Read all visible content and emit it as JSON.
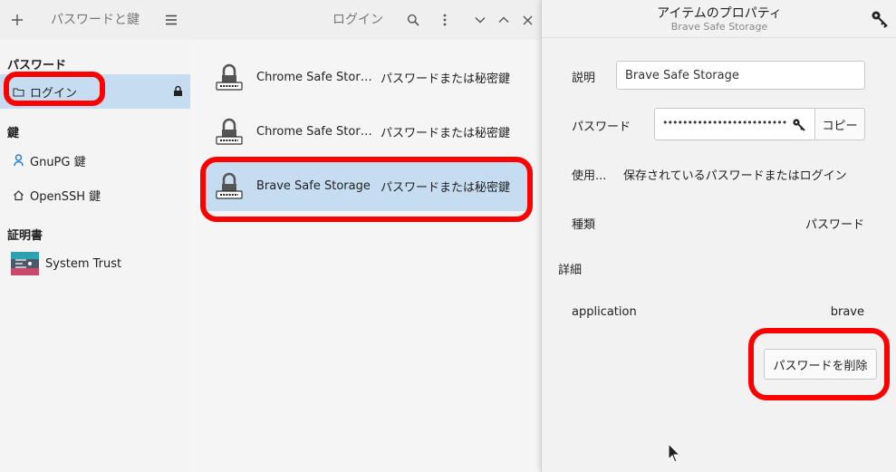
{
  "header": {
    "add_icon": "plus-icon",
    "title": "パスワードと鍵",
    "menu_icon": "hamburger-menu-icon",
    "section_title": "ログイン",
    "search_icon": "search-icon",
    "more_icon": "vertical-dots-icon",
    "down_icon": "chevron-down-icon",
    "up_icon": "chevron-up-icon",
    "close_icon": "close-icon"
  },
  "sidebar": {
    "passwords_header": "パスワード",
    "login_label": "ログイン",
    "keys_header": "鍵",
    "gnupg_label": "GnuPG 鍵",
    "openssh_label": "OpenSSH 鍵",
    "certs_header": "証明書",
    "system_trust_label": "System Trust"
  },
  "list": {
    "rows": [
      {
        "name": "Chrome Safe Storage",
        "type": "パスワードまたは秘密鍵"
      },
      {
        "name": "Chrome Safe Storag...",
        "type": "パスワードまたは秘密鍵"
      },
      {
        "name": "Brave Safe Storage",
        "type": "パスワードまたは秘密鍵"
      }
    ]
  },
  "panel": {
    "title": "アイテムのプロパティ",
    "subtitle": "Brave Safe Storage",
    "description_label": "説明",
    "description_value": "Brave Safe Storage",
    "password_label": "パスワード",
    "password_value": "•••••••••••••••••••••••••",
    "copy_label": "コピー",
    "usage_label": "使用...",
    "usage_value": "保存されているパスワードまたはログイン",
    "kind_label": "種類",
    "kind_value": "パスワード",
    "details_header": "詳細",
    "attr_key": "application",
    "attr_value": "brave",
    "delete_label": "パスワードを削除"
  },
  "colors": {
    "selection": "#c6ddf1",
    "annotation": "#ff0000"
  }
}
